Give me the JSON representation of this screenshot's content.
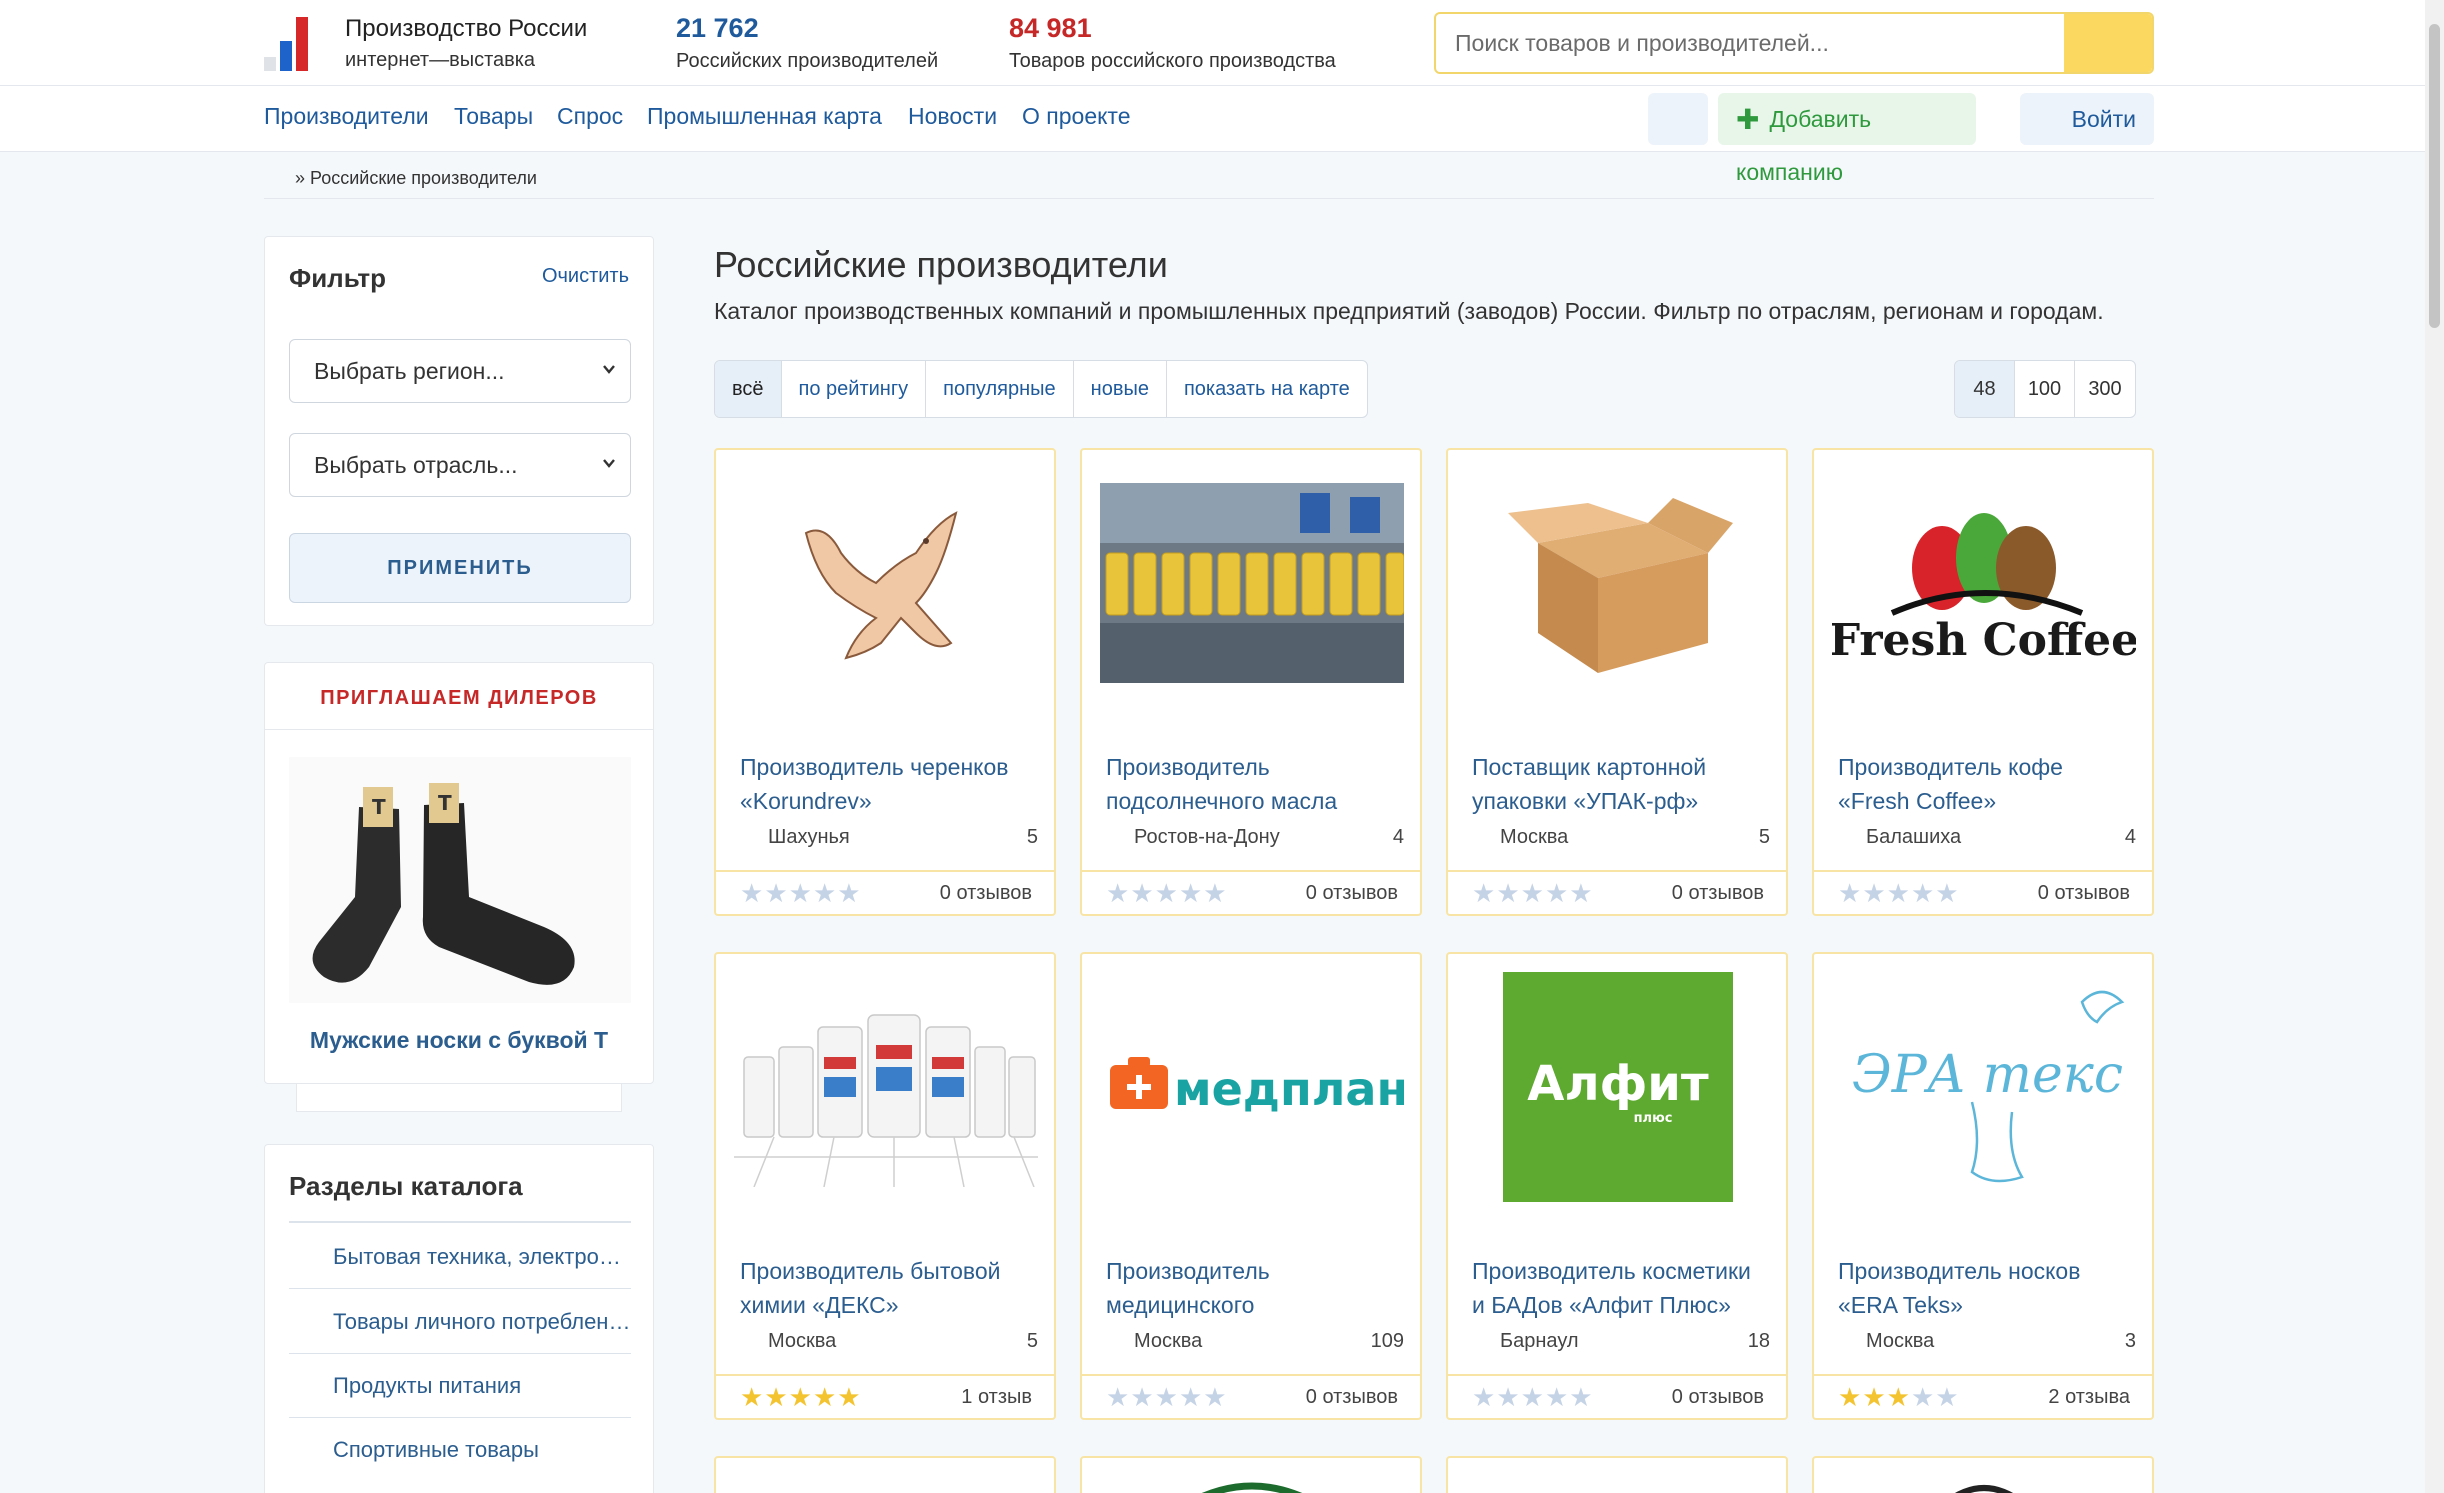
{
  "header": {
    "logo_title": "Производство России",
    "logo_subtitle": "интернет—выставка",
    "stats": [
      {
        "number": "21 762",
        "label": "Российских производителей",
        "color": "#1e5a9c"
      },
      {
        "number": "84 981",
        "label": "Товаров российского производства",
        "color": "#c62828"
      }
    ],
    "search_placeholder": "Поиск товаров и производителей..."
  },
  "nav": {
    "items": [
      "Производители",
      "Товары",
      "Спрос",
      "Промышленная карта",
      "Новости",
      "О проекте"
    ],
    "add_company": "Добавить компанию",
    "login": "Войти"
  },
  "breadcrumb": "» Российские производители",
  "filter": {
    "title": "Фильтр",
    "clear": "Очистить",
    "region_select": "Выбрать регион...",
    "industry_select": "Выбрать отрасль...",
    "apply": "ПРИМЕНИТЬ"
  },
  "dealers": {
    "title": "ПРИГЛАШАЕМ ДИЛЕРОВ",
    "caption": "Мужские носки с буквой Т"
  },
  "catalog": {
    "title": "Разделы каталога",
    "items": [
      "Бытовая техника, электроника",
      "Товары личного потребления",
      "Продукты питания",
      "Спортивные товары"
    ]
  },
  "main": {
    "title": "Российские производители",
    "description": "Каталог производственных компаний и промышленных предприятий (заводов) России. Фильтр по отраслям, регионам и городам.",
    "tabs": [
      "всё",
      "по рейтингу",
      "популярные",
      "новые",
      "показать на карте"
    ],
    "active_tab": 0,
    "page_sizes": [
      "48",
      "100",
      "300"
    ],
    "active_page_size": 0
  },
  "cards": [
    {
      "name_line1": "Производитель черенков",
      "name_line2": "«Korundrev»",
      "city": "Шахунья",
      "count": "5",
      "rating": 0,
      "reviews": "0 отзывов",
      "image": "eagle-wood"
    },
    {
      "name_line1": "Производитель",
      "name_line2": "подсолнечного масла",
      "city": "Ростов-на-Дону",
      "count": "4",
      "rating": 0,
      "reviews": "0 отзывов",
      "image": "oil-bottles"
    },
    {
      "name_line1": "Поставщик картонной",
      "name_line2": "упаковки «УПАК-рф»",
      "city": "Москва",
      "count": "5",
      "rating": 0,
      "reviews": "0 отзывов",
      "image": "cardboard-box"
    },
    {
      "name_line1": "Производитель кофе",
      "name_line2": "«Fresh Coffee»",
      "city": "Балашиха",
      "count": "4",
      "rating": 0,
      "reviews": "0 отзывов",
      "image": "fresh-coffee-logo",
      "logo_text": "Fresh Coffee"
    },
    {
      "name_line1": "Производитель бытовой",
      "name_line2": "химии «ДЕКС»",
      "city": "Москва",
      "count": "5",
      "rating": 5,
      "reviews": "1 отзыв",
      "image": "chemical-bottles"
    },
    {
      "name_line1": "Производитель",
      "name_line2": "медицинского",
      "city": "Москва",
      "count": "109",
      "rating": 0,
      "reviews": "0 отзывов",
      "image": "medplant-logo",
      "logo_text": "медплант"
    },
    {
      "name_line1": "Производитель косметики",
      "name_line2": "и БАДов «Алфит Плюс»",
      "city": "Барнаул",
      "count": "18",
      "rating": 0,
      "reviews": "0 отзывов",
      "image": "alfit-logo",
      "logo_text": "Алфит",
      "logo_sub": "плюс"
    },
    {
      "name_line1": "Производитель носков",
      "name_line2": "«ERA Teks»",
      "city": "Москва",
      "count": "3",
      "rating": 3,
      "reviews": "2 отзыва",
      "image": "era-teks-logo",
      "logo_text": "ЭРА текс"
    }
  ],
  "colors": {
    "link": "#1e5a9c",
    "accent_red": "#c62828",
    "card_border": "#f8e4a4",
    "star_on": "#f4c430",
    "star_off": "#c5d3e6"
  }
}
